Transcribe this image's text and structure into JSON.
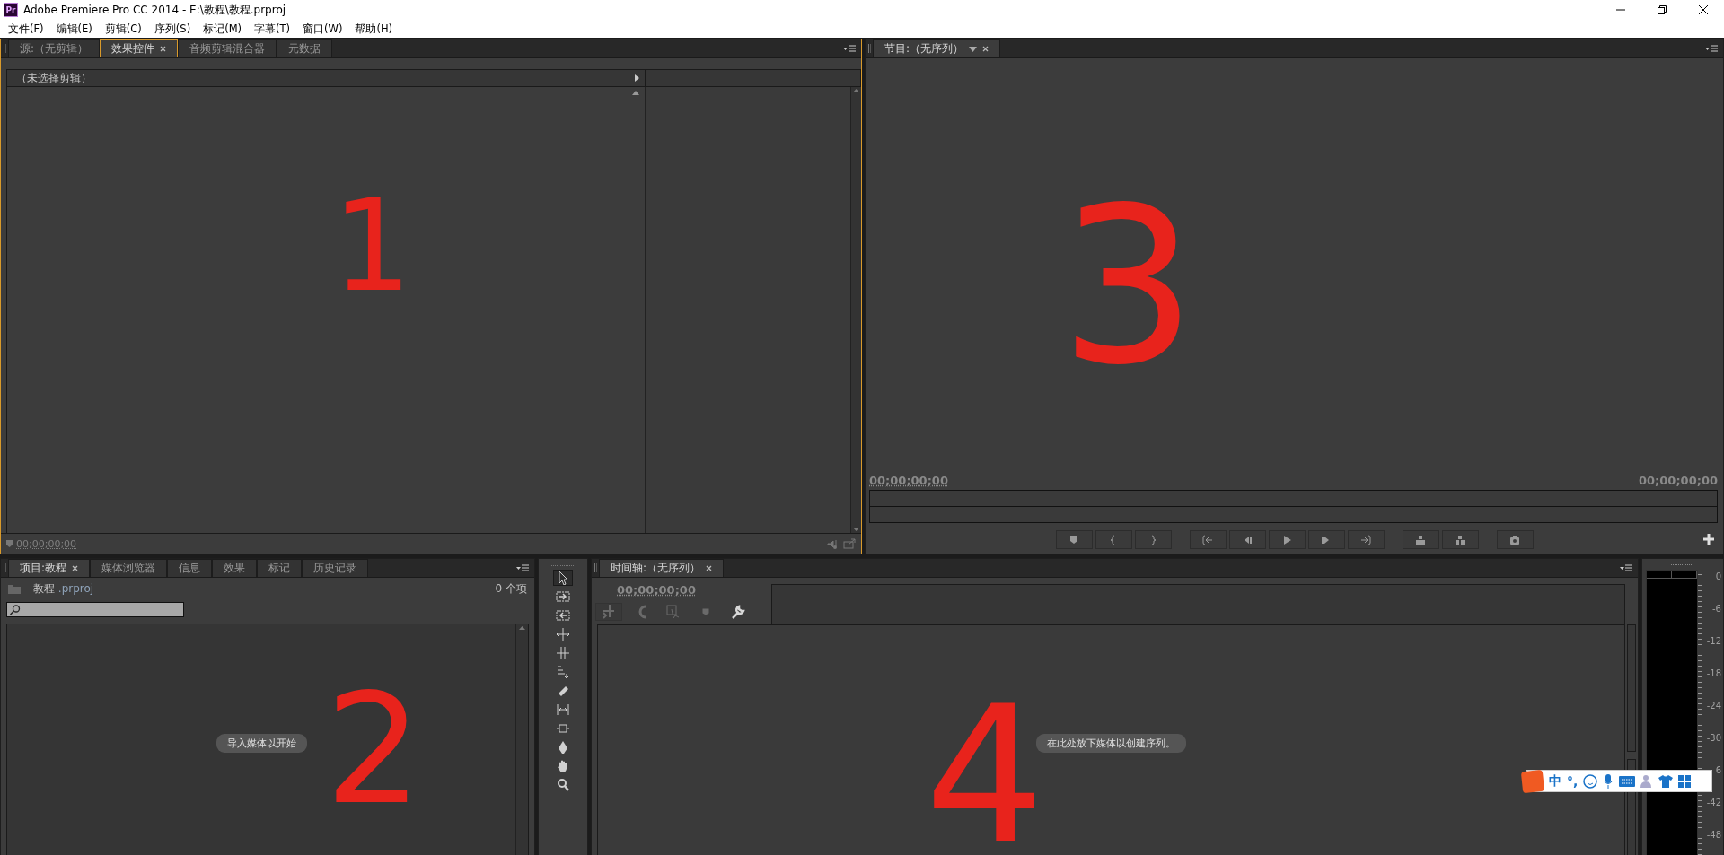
{
  "window": {
    "app_icon": "Pr",
    "title": "Adobe Premiere Pro CC 2014 - E:\\教程\\教程.prproj"
  },
  "menu": [
    "文件(F)",
    "编辑(E)",
    "剪辑(C)",
    "序列(S)",
    "标记(M)",
    "字幕(T)",
    "窗口(W)",
    "帮助(H)"
  ],
  "source_panel": {
    "tabs": [
      {
        "label": "源:（无剪辑）",
        "selected": false
      },
      {
        "label": "效果控件",
        "selected": true
      },
      {
        "label": "音频剪辑混合器",
        "selected": false
      },
      {
        "label": "元数据",
        "selected": false
      }
    ],
    "clip_header": "（未选择剪辑）",
    "timecode": "00;00;00;00"
  },
  "program_monitor": {
    "tabs": [
      {
        "label": "节目:（无序列）",
        "selected": true
      }
    ],
    "timecode_left": "00;00;00;00",
    "timecode_right": "00;00;00;00"
  },
  "project_panel": {
    "tabs": [
      {
        "label": "项目:教程",
        "selected": true
      },
      {
        "label": "媒体浏览器",
        "selected": false
      },
      {
        "label": "信息",
        "selected": false
      },
      {
        "label": "效果",
        "selected": false
      },
      {
        "label": "标记",
        "selected": false
      },
      {
        "label": "历史记录",
        "selected": false
      }
    ],
    "project_name": "教程",
    "extension": ".prproj",
    "item_count": "0 个项",
    "hint": "导入媒体以开始"
  },
  "timeline": {
    "tabs": [
      {
        "label": "时间轴:（无序列）",
        "selected": true
      }
    ],
    "timecode": "00;00;00;00",
    "hint": "在此处放下媒体以创建序列。"
  },
  "audio_meter": {
    "scale": [
      "0",
      "-6",
      "-12",
      "-18",
      "-24",
      "-30",
      "6",
      "-42",
      "-48"
    ]
  },
  "ime_toolbar": {
    "mode": "中",
    "punctuation": "°,"
  },
  "annotations": [
    "1",
    "3",
    "2",
    "4"
  ]
}
